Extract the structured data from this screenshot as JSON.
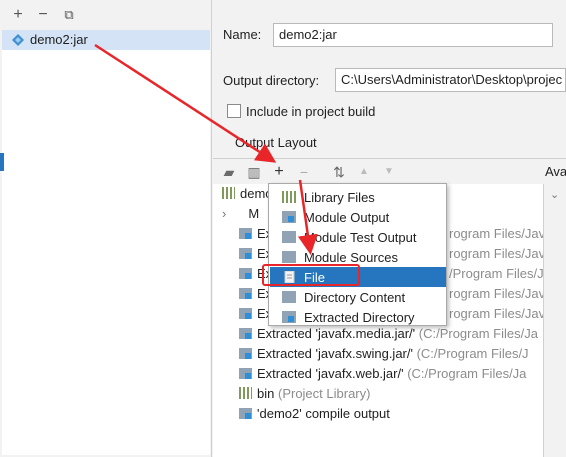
{
  "left": {
    "toolbar": {
      "add": "+",
      "remove": "−",
      "copy": "⧉"
    },
    "artifact": {
      "label": "demo2:jar"
    }
  },
  "form": {
    "name_label": "Name:",
    "name_value": "demo2:jar",
    "output_label": "Output directory:",
    "output_value": "C:\\Users\\Administrator\\Desktop\\projec",
    "include_label": "Include in project build",
    "layout_label": "Output Layout",
    "available_label": "Ava"
  },
  "tree": {
    "rows": [
      {
        "text": "demo",
        "gray": ""
      },
      {
        "text": "M",
        "gray": ""
      },
      {
        "text": "Ext",
        "gray": "rogram Files/Java/ja"
      },
      {
        "text": "Ext",
        "gray": "rogram Files/Java/jc"
      },
      {
        "text": "Ext",
        "gray": "/Program Files/Java/"
      },
      {
        "text": "Ext",
        "gray": "rogram Files/Java/jc"
      },
      {
        "text": "Ext",
        "gray": "rogram Files/Java/ja"
      },
      {
        "text": "Extracted 'javafx.media.jar/'",
        "gray": "(C:/Program Files/Ja"
      },
      {
        "text": "Extracted 'javafx.swing.jar/'",
        "gray": "(C:/Program Files/J"
      },
      {
        "text": "Extracted 'javafx.web.jar/'",
        "gray": "(C:/Program Files/Ja"
      },
      {
        "text": "bin",
        "gray": "(Project Library)"
      },
      {
        "text": "'demo2' compile output",
        "gray": ""
      }
    ]
  },
  "popup": {
    "items": [
      {
        "label": "Library Files"
      },
      {
        "label": "Module Output"
      },
      {
        "label": "Module Test Output"
      },
      {
        "label": "Module Sources"
      },
      {
        "label": "File"
      },
      {
        "label": "Directory Content"
      },
      {
        "label": "Extracted Directory"
      }
    ],
    "selected_index": 4
  },
  "colors": {
    "accent": "#2675bf",
    "annotation": "#e8262a",
    "selection_bg": "#d5e3f6"
  }
}
